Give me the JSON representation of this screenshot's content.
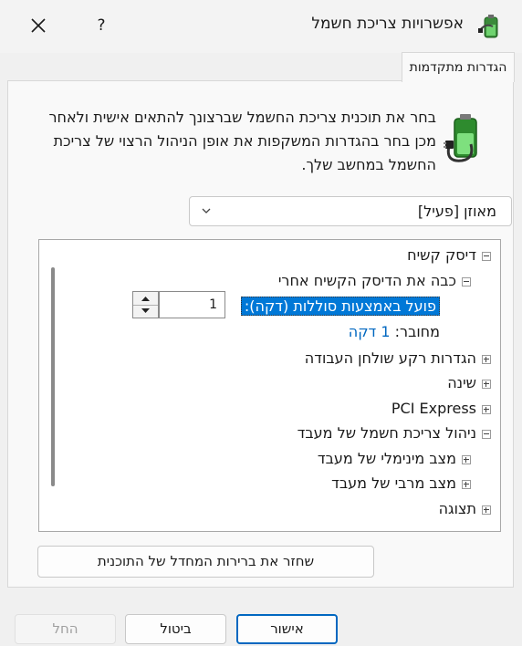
{
  "window": {
    "title": "אפשרויות צריכת חשמל",
    "help_label": "?",
    "close_label": "✕"
  },
  "tab": {
    "label": "הגדרות מתקדמות"
  },
  "description": "בחר את תוכנית צריכת החשמל שברצונך להתאים אישית ולאחר מכן בחר בהגדרות המשקפות את אופן הניהול הרצוי של צריכת החשמל במחשב שלך.",
  "plan_dropdown": {
    "value": "מאוזן [פעיל]"
  },
  "tree": {
    "hard_disk": "דיסק קשיח",
    "turn_off_after": "כבה את הדיסק הקשיח אחרי",
    "on_battery_label": "פועל באמצעות סוללות (דקה):",
    "on_battery_value": "1",
    "plugged_in_label": "מחובר:",
    "plugged_in_value": "1 דקה",
    "desktop_bg": "הגדרות רקע שולחן העבודה",
    "sleep": "שינה",
    "pci_express": "PCI Express",
    "processor_mgmt": "ניהול צריכת חשמל של מעבד",
    "min_processor": "מצב מינימלי של מעבד",
    "max_processor": "מצב מרבי של מעבד",
    "display": "תצוגה"
  },
  "buttons": {
    "restore": "שחזר את ברירות המחדל של התוכנית",
    "ok": "אישור",
    "cancel": "ביטול",
    "apply": "החל"
  },
  "colors": {
    "selection": "#0078d7",
    "link": "#0067c0",
    "accent": "#0067c0"
  }
}
